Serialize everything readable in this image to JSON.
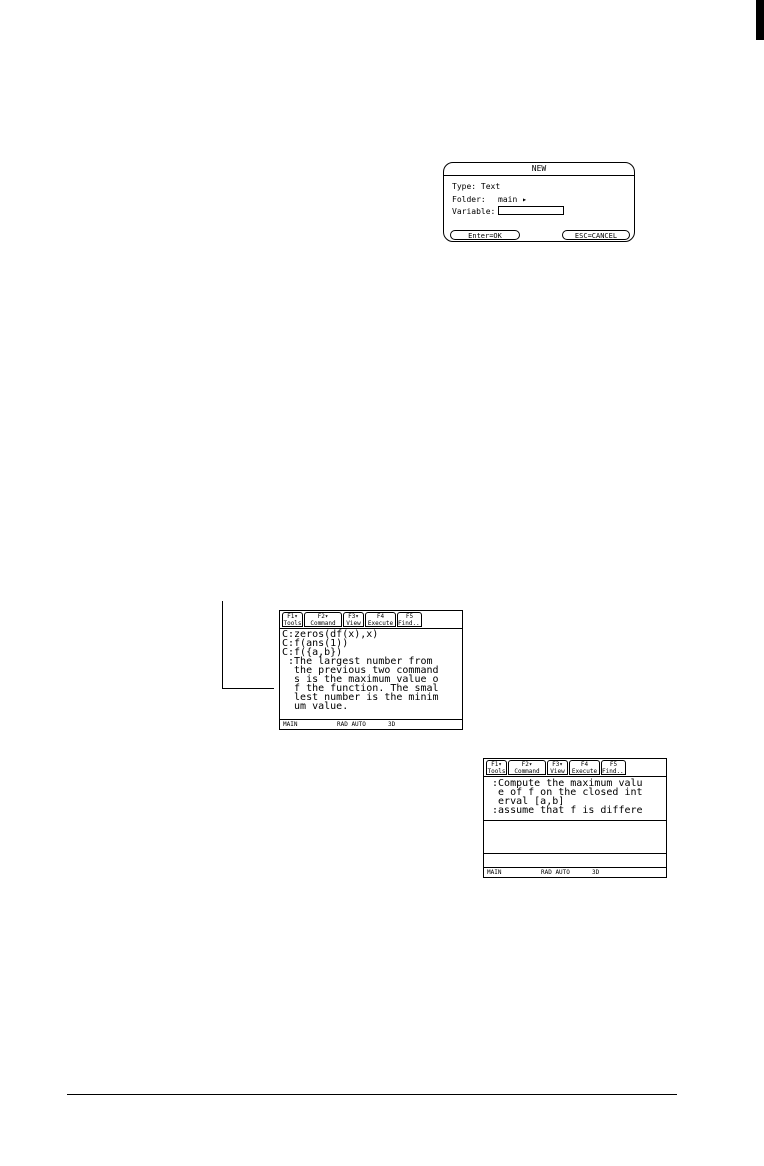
{
  "new_dialog": {
    "title": "NEW",
    "type_line": "Type: Text",
    "folder_label": "Folder:",
    "folder_value": "main ▸",
    "variable_label": "Variable:",
    "ok_button": "Enter=OK",
    "cancel_button": "ESC=CANCEL"
  },
  "toolbar": {
    "tabs": [
      {
        "key": "F1▾",
        "label": "Tools"
      },
      {
        "key": "F2▾",
        "label": "Command"
      },
      {
        "key": "F3▾",
        "label": "View"
      },
      {
        "key": "F4",
        "label": "Execute"
      },
      {
        "key": "F5",
        "label": "Find..."
      }
    ]
  },
  "screen1": {
    "lines": [
      "C:zeros(df(x),x)",
      "C:f(ans(1))",
      "C:f({a,b})",
      " :The largest number from",
      "  the previous two command",
      "  s is the maximum_value o",
      "  f the function. The smal",
      "  lest number is the minim",
      "  um value."
    ]
  },
  "screen2": {
    "lines": [
      " :Compute the maximum valu",
      "  e of f on the closed int",
      "  erval [a,b]",
      " :assume that f is differe"
    ]
  },
  "status_bar": {
    "folder": "MAIN",
    "mode": "RAD AUTO",
    "graph": "3D"
  }
}
